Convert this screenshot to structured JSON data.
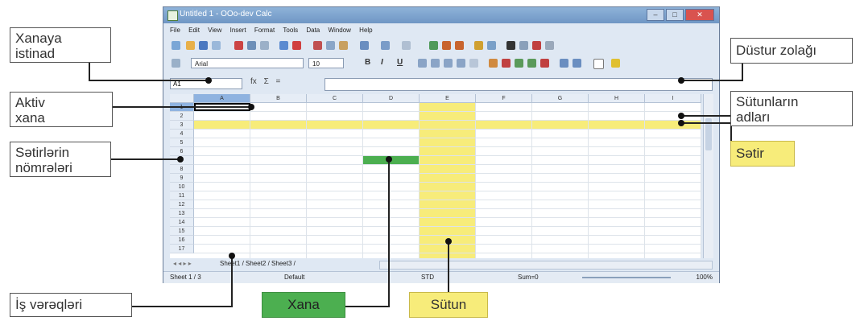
{
  "window": {
    "title": "Untitled 1 - OOo-dev Calc",
    "menu": [
      "File",
      "Edit",
      "View",
      "Insert",
      "Format",
      "Tools",
      "Data",
      "Window",
      "Help"
    ],
    "font_name": "Arial",
    "font_size": "10",
    "format_buttons": [
      "B",
      "I",
      "U"
    ],
    "name_box": "A1",
    "formula_icons": [
      "fx",
      "Σ",
      "="
    ],
    "columns": [
      "A",
      "B",
      "C",
      "D",
      "E",
      "F",
      "G",
      "H",
      "I"
    ],
    "rows": [
      "1",
      "2",
      "3",
      "4",
      "5",
      "6",
      "7",
      "8",
      "9",
      "10",
      "11",
      "12",
      "13",
      "14",
      "15",
      "16",
      "17"
    ],
    "sheet_tabs": "Sheet1 / Sheet2 / Sheet3 /",
    "status": {
      "sheet": "Sheet 1 / 3",
      "style": "Default",
      "mode": "STD",
      "sum": "Sum=0",
      "zoom": "100%"
    },
    "highlight_colors": {
      "yellow": "#f7ec7a",
      "green": "#4caf50"
    }
  },
  "callouts": {
    "xanaya_istinad": [
      "Xanaya",
      "istinad"
    ],
    "aktiv_xana": [
      "Aktiv",
      "xana"
    ],
    "setirlerin_nomreleri": [
      "Sətirlərin",
      "nömrələri"
    ],
    "is_vereqleri": "İş vərəqləri",
    "xana": "Xana",
    "sutun": "Sütun",
    "dustur_zolagi": "Düstur zolağı",
    "sutunlarin_adlari": [
      "Sütunların",
      "adları"
    ],
    "setir": "Sətir"
  }
}
